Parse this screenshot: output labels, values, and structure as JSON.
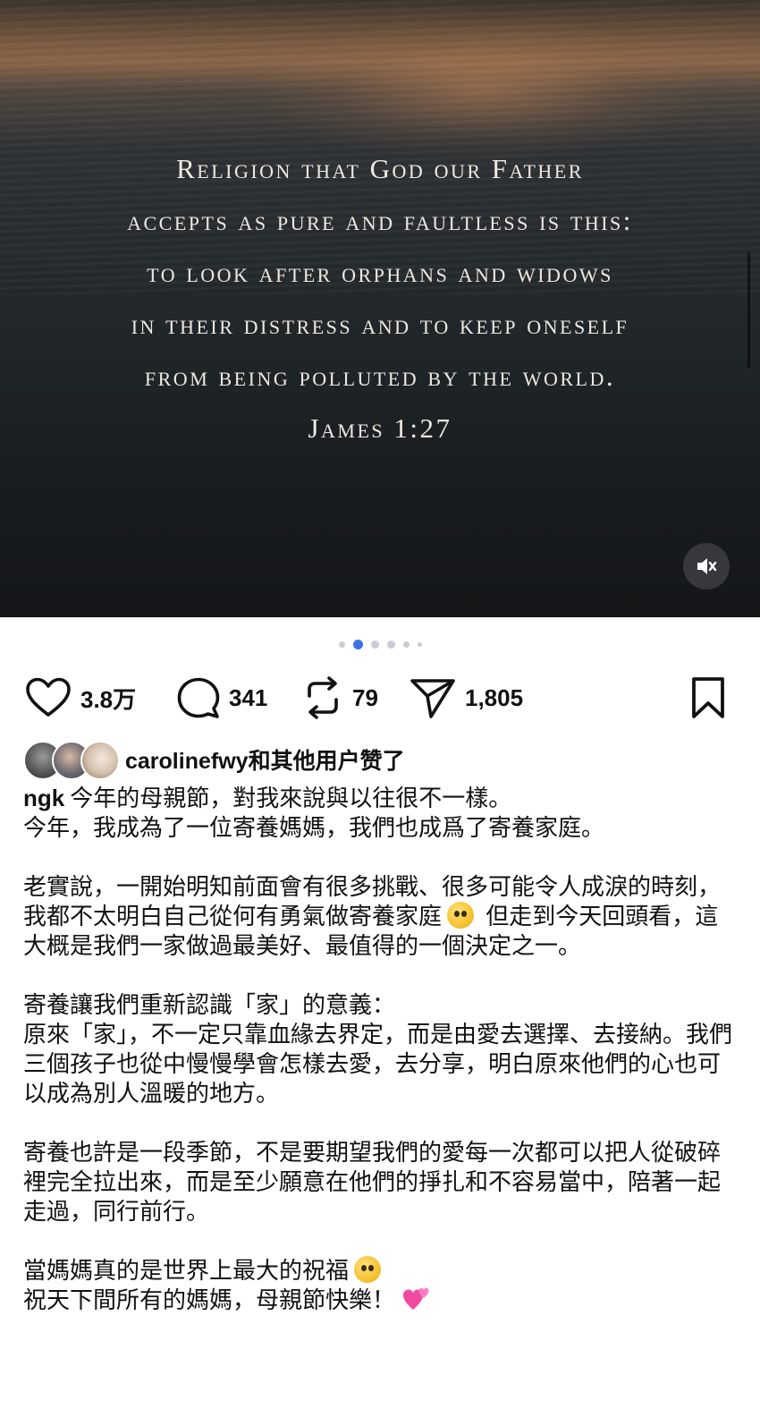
{
  "post_image": {
    "quote_lines": [
      "Religion that God our Father",
      "accepts as pure and faultless is this:",
      "to look after orphans and widows",
      "in their distress and to keep oneself",
      "from being polluted by the world.",
      "James 1:27"
    ],
    "mute_icon": "speaker-muted-icon"
  },
  "carousel": {
    "total": 6,
    "active_index": 1
  },
  "actions": {
    "like_count": "3.8万",
    "comment_count": "341",
    "repost_count": "79",
    "share_count": "1,805",
    "icons": [
      "heart-icon",
      "comment-icon",
      "repost-icon",
      "send-icon",
      "bookmark-icon"
    ]
  },
  "liked_by": {
    "username": "carolinefwy",
    "suffix": "和其他用户赞了"
  },
  "caption": {
    "username": "ngk",
    "first_line": "今年的母親節，對我來說與以往很不一樣。",
    "line2": "今年，我成為了一位寄養媽媽，我們也成爲了寄養家庭。",
    "para2_part1": "老實說，一開始明知前面會有很多挑戰、很多可能令人成淚的時刻，我都不太明白自己從何有勇氣做寄養家庭",
    "para2_part2": " 但走到今天回頭看，這大概是我們一家做過最美好、最值得的一個決定之一。",
    "para3_line1": "寄養讓我們重新認識「家」的意義：",
    "para3_line2": "原來「家」，不一定只靠血緣去界定，而是由愛去選擇、去接納。我們三個孩子也從中慢慢學會怎樣去愛，去分享，明白原來他們的心也可以成為別人溫暖的地方。",
    "para4": "寄養也許是一段季節，不是要期望我們的愛每一次都可以把人從破碎裡完全拉出來，而是至少願意在他們的掙扎和不容易當中，陪著一起走過，同行前行。",
    "para5_line1": "當媽媽真的是世界上最大的祝福",
    "para5_line2": "祝天下間所有的媽媽，母親節快樂！"
  },
  "colors": {
    "carousel_active": "#3b72e6",
    "carousel_inactive": "#c9cdd3",
    "text": "#111111"
  }
}
